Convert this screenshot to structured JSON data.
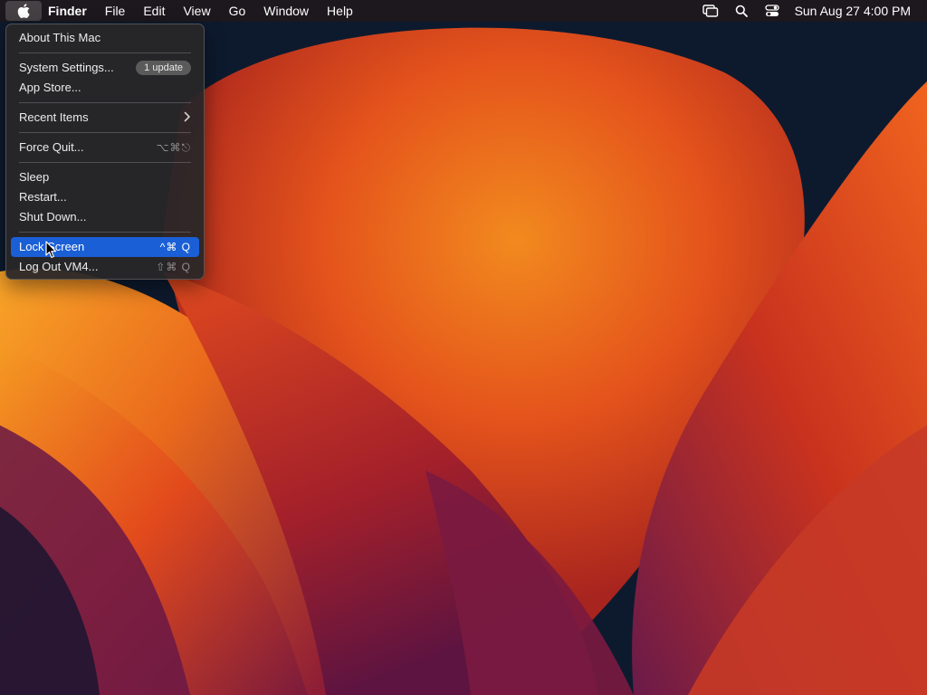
{
  "menubar": {
    "apple_icon": "apple-logo-icon",
    "app_name": "Finder",
    "menus": [
      "File",
      "Edit",
      "View",
      "Go",
      "Window",
      "Help"
    ],
    "status_icons": [
      "screen-mirroring-icon",
      "spotlight-search-icon",
      "control-center-icon"
    ],
    "clock": "Sun Aug 27  4:00 PM"
  },
  "apple_menu": {
    "about": "About This Mac",
    "system_settings": "System Settings...",
    "update_badge": "1 update",
    "app_store": "App Store...",
    "recent_items": "Recent Items",
    "force_quit": "Force Quit...",
    "force_quit_shortcut": "⌥⌘⎋",
    "sleep": "Sleep",
    "restart": "Restart...",
    "shut_down": "Shut Down...",
    "lock_screen": "Lock Screen",
    "lock_screen_shortcut": "^⌘ Q",
    "log_out": "Log Out VM4...",
    "log_out_shortcut": "⇧⌘ Q"
  },
  "colors": {
    "highlight": "#1a5fd6",
    "wallpaper_orange": "#f07a1c",
    "wallpaper_red": "#c8321e",
    "wallpaper_purple": "#6a1a4a",
    "wallpaper_navy": "#0d1a2e"
  }
}
